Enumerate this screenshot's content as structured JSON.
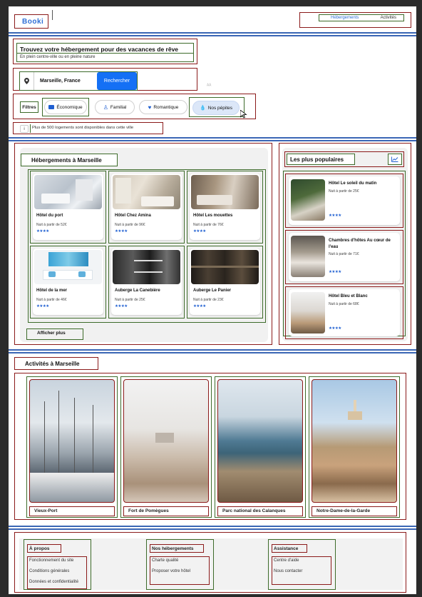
{
  "header": {
    "logo": "Booki",
    "nav": [
      "Hébergements",
      "Activités"
    ]
  },
  "hero": {
    "title": "Trouvez votre hébergement pour des vacances de rêve",
    "subtitle": "En plein centre-ville ou en pleine nature"
  },
  "search": {
    "value": "Marseille, France",
    "button": "Rechercher"
  },
  "filters": {
    "label": "Filtres",
    "chips": [
      {
        "label": "Économique",
        "icon": "money-icon"
      },
      {
        "label": "Familial",
        "icon": "person-icon"
      },
      {
        "label": "Romantique",
        "icon": "heart-icon"
      },
      {
        "label": "Nos pépites",
        "icon": "droplet-icon"
      }
    ]
  },
  "info": {
    "icon_glyph": "i",
    "text": "Plus de 500 logements sont disponibles dans cette ville"
  },
  "accommodations": {
    "title": "Hébergements à Marseille",
    "items": [
      {
        "name": "Hôtel du port",
        "price": "Nuit à partir de 52€",
        "stars": "★★★★"
      },
      {
        "name": "Hôtel Chez Amina",
        "price": "Nuit à partir de 96€",
        "stars": "★★★★"
      },
      {
        "name": "Hôtel Les mouettes",
        "price": "Nuit à partir de 76€",
        "stars": "★★★★"
      },
      {
        "name": "Hôtel de la mer",
        "price": "Nuit à partir de 46€",
        "stars": "★★★★"
      },
      {
        "name": "Auberge La Canebière",
        "price": "Nuit à partir de 25€",
        "stars": "★★★★"
      },
      {
        "name": "Auberge Le Panier",
        "price": "Nuit à partir de 23€",
        "stars": "★★★★"
      }
    ],
    "more": "Afficher plus"
  },
  "popular": {
    "title": "Les plus populaires",
    "items": [
      {
        "name": "Hôtel Le soleil du matin",
        "price": "Nuit à partir de 25€",
        "stars": "★★★★"
      },
      {
        "name": "Chambres d'hôtes Au cœur de l'eau",
        "price": "Nuit à partir de 71€",
        "stars": "★★★★"
      },
      {
        "name": "Hôtel Bleu et Blanc",
        "price": "Nuit à partir de 68€",
        "stars": "★★★★"
      }
    ]
  },
  "activities": {
    "title": "Activités à Marseille",
    "items": [
      "Vieux-Port",
      "Fort de Pomègues",
      "Parc national des Calanques",
      "Notre-Dame-de-la-Garde"
    ]
  },
  "footer": {
    "columns": [
      {
        "title": "À propos",
        "links": [
          "Fonctionnement du site",
          "Conditions générales",
          "Données et confidentialité"
        ]
      },
      {
        "title": "Nos hébergements",
        "links": [
          "Charte qualité",
          "Proposer votre hôtel"
        ]
      },
      {
        "title": "Assistance",
        "links": [
          "Centre d'aide",
          "Nous contacter"
        ]
      }
    ]
  },
  "colors": {
    "accent": "#1470f5",
    "stars": "#1f5fd1",
    "chip_active": "#dce7f8"
  }
}
